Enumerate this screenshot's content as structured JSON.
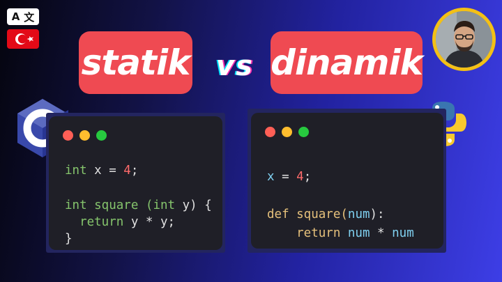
{
  "translate_badge": {
    "left_glyph": "A",
    "right_glyph": "文",
    "icon": "translate-icon",
    "flag": "turkey-flag-icon"
  },
  "title": {
    "left_label": "statik",
    "vs_label": "vs",
    "right_label": "dinamik"
  },
  "colors": {
    "pill": "#ef4a52",
    "avatar_ring": "#f3c016",
    "frame": "#23255f",
    "editor_bg": "#1f1f27"
  },
  "logos": {
    "left": "c-language-logo",
    "right": "python-logo"
  },
  "left_code": {
    "line1": {
      "kw": "int",
      "rest": " x = ",
      "num": "4",
      "end": ";"
    },
    "line2": {
      "kw": "int",
      "fn": " square (",
      "kw2": "int",
      "rest": " y) {"
    },
    "line3": {
      "kw": "  return",
      "rest": " y * y;"
    },
    "line4": {
      "rest": "}"
    }
  },
  "right_code": {
    "line1": {
      "ident": "x",
      "rest": " = ",
      "num": "4",
      "end": ";"
    },
    "line2": {
      "kw": "def",
      "fn": " square(",
      "ident": "num",
      "end": "):"
    },
    "line3": {
      "kw": "    return",
      "ident1": " num",
      "op": " * ",
      "ident2": "num"
    }
  }
}
